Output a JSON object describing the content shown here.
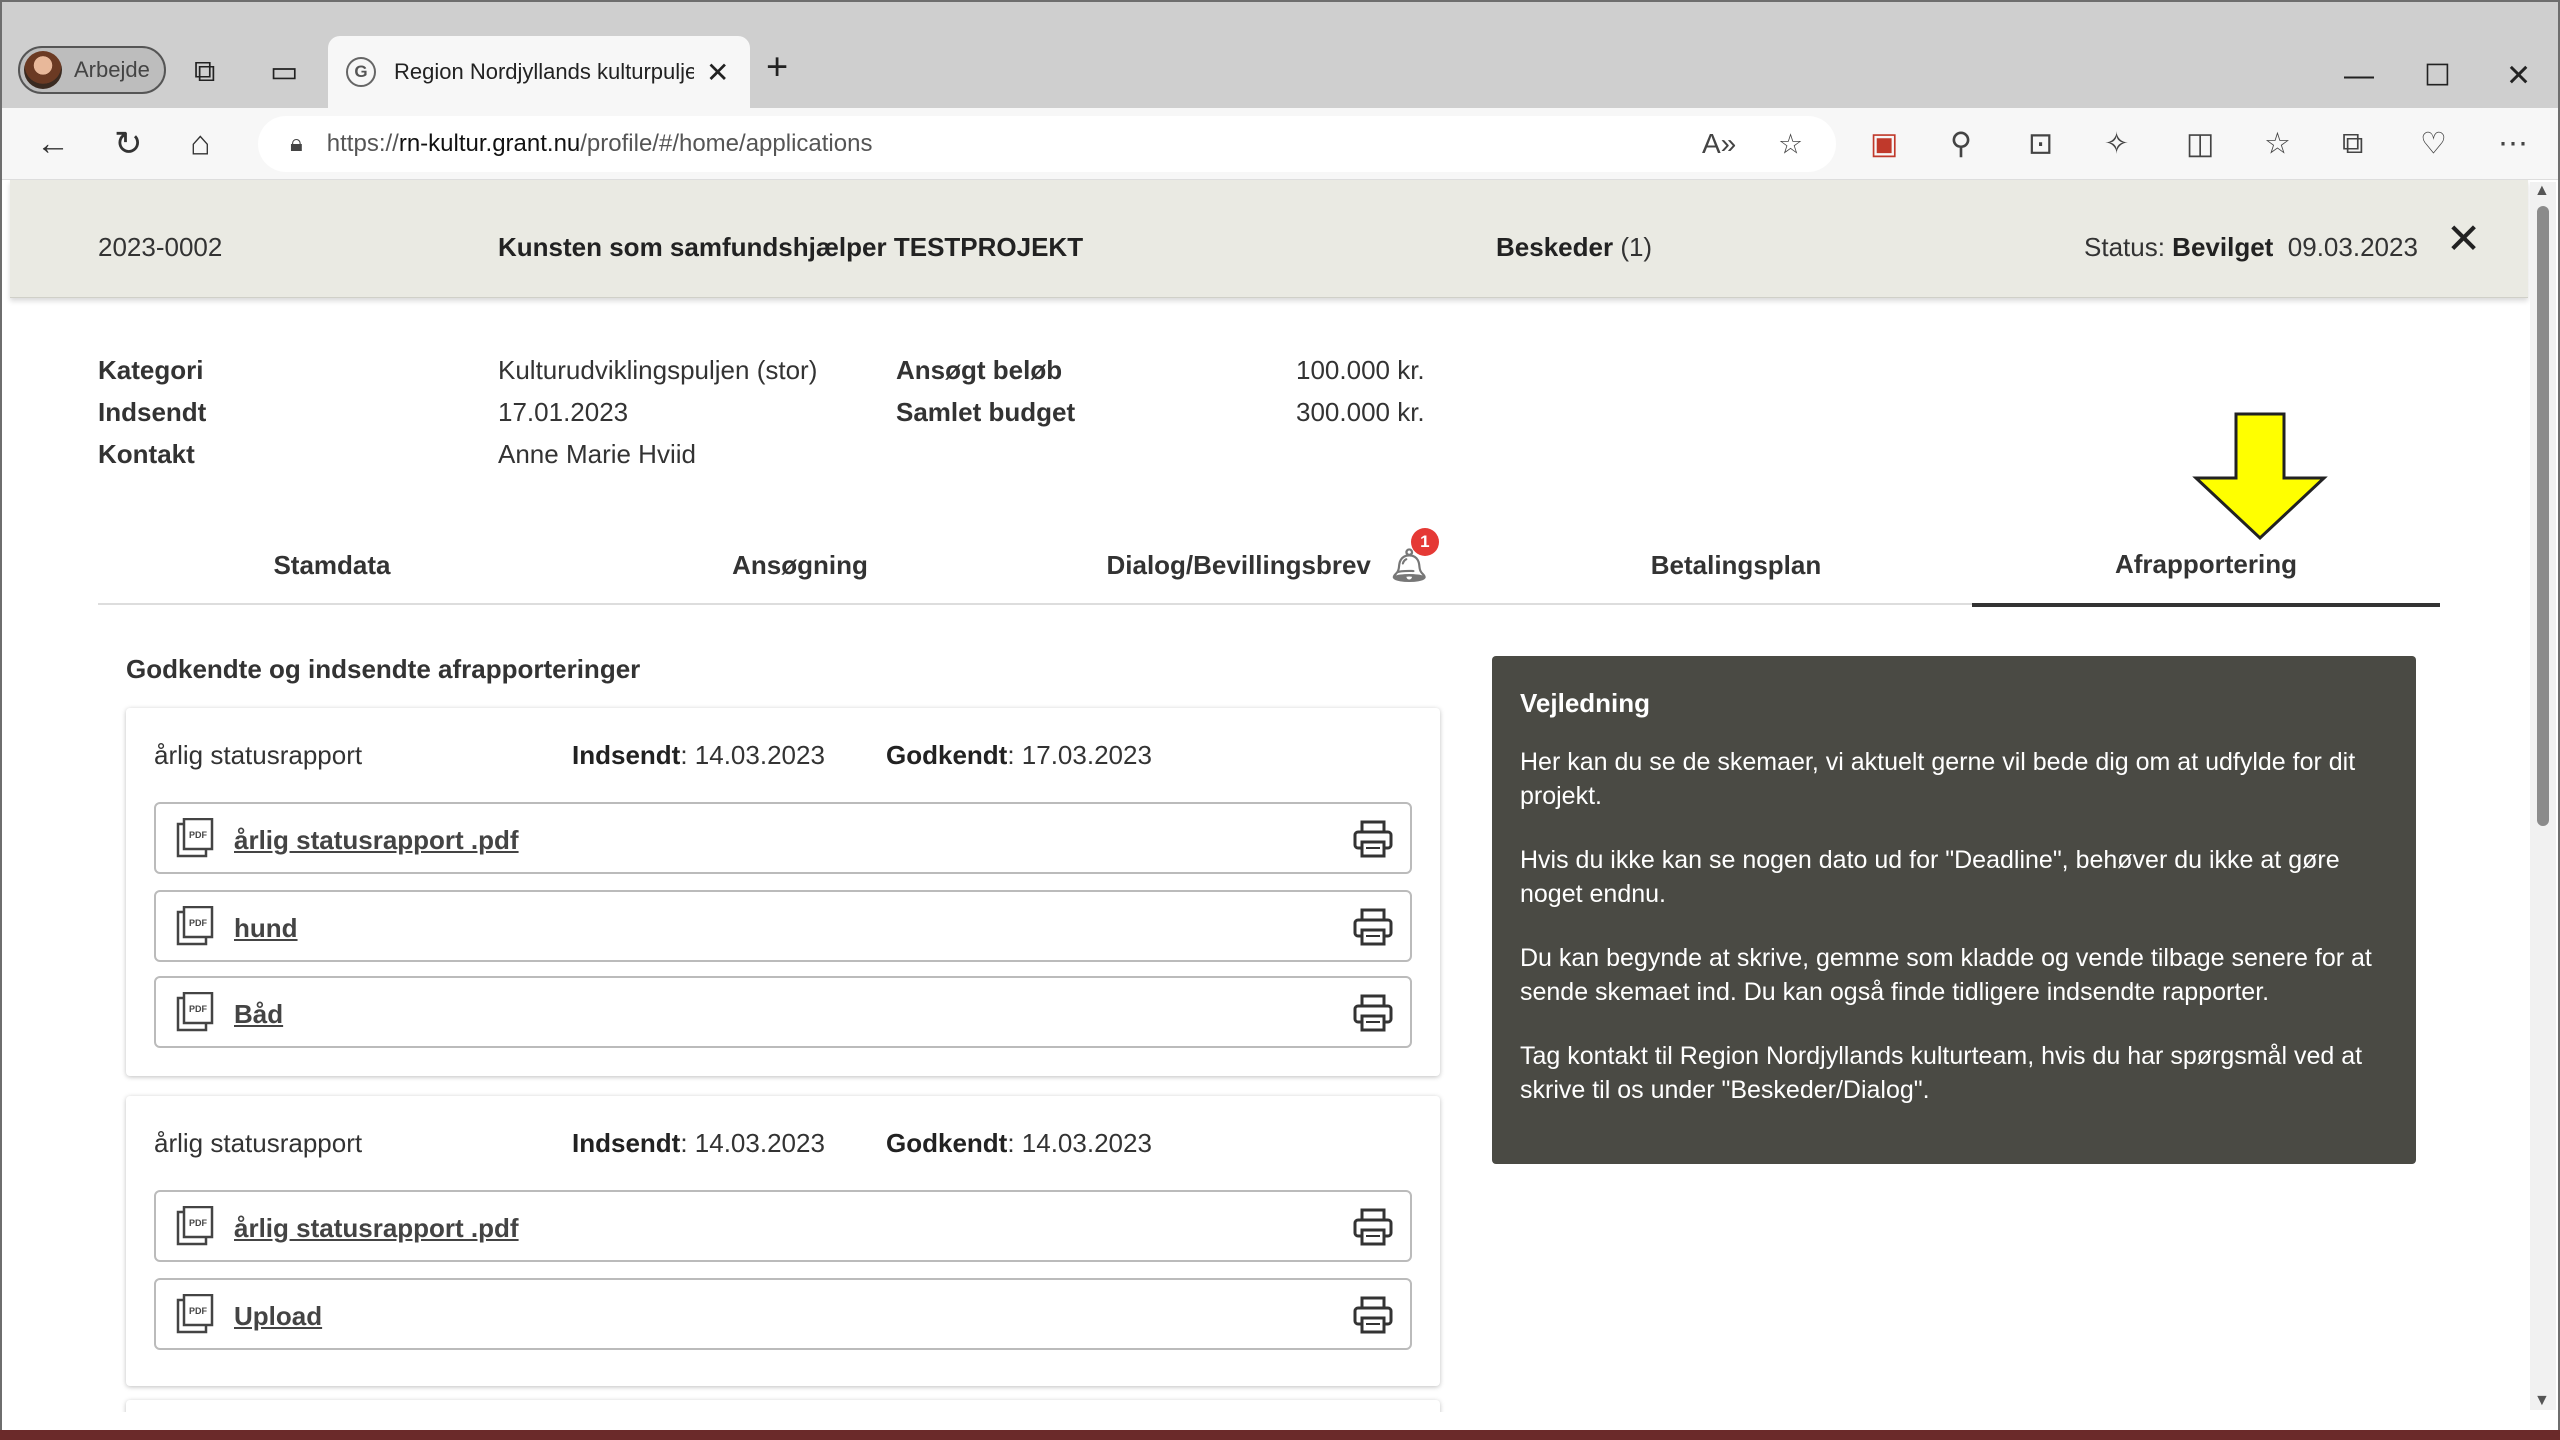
{
  "browser": {
    "profile_name": "Arbejde",
    "tab_title": "Region Nordjyllands kulturpuljer",
    "tab_favicon_letter": "G",
    "url_prefix": "https://",
    "url_domain": "rn-kultur.grant.nu",
    "url_path": "/profile/#/home/applications"
  },
  "header": {
    "app_id": "2023-0002",
    "project_title": "Kunsten som samfundshjælper TESTPROJEKT",
    "messages_label": "Beskeder",
    "messages_count": "(1)",
    "status_label": "Status:",
    "status_value": "Bevilget",
    "status_date": "09.03.2023"
  },
  "meta": {
    "kategori_label": "Kategori",
    "kategori_value": "Kulturudviklingspuljen (stor)",
    "indsendt_label": "Indsendt",
    "indsendt_value": "17.01.2023",
    "kontakt_label": "Kontakt",
    "kontakt_value": "Anne Marie Hviid",
    "ansogt_label": "Ansøgt beløb",
    "ansogt_value": "100.000 kr.",
    "budget_label": "Samlet budget",
    "budget_value": "300.000 kr."
  },
  "tabs": [
    {
      "label": "Stamdata"
    },
    {
      "label": "Ansøgning"
    },
    {
      "label": "Dialog/Bevillingsbrev",
      "badge": "1"
    },
    {
      "label": "Betalingsplan"
    },
    {
      "label": "Afrapportering"
    }
  ],
  "reports_section": {
    "title": "Godkendte og indsendte afrapporteringer",
    "cards": [
      {
        "name": "årlig statusrapport",
        "submitted_label": "Indsendt",
        "submitted_value": ": 14.03.2023",
        "approved_label": "Godkendt",
        "approved_value": ": 17.03.2023",
        "files": [
          "årlig statusrapport .pdf",
          "hund",
          "Båd"
        ]
      },
      {
        "name": "årlig statusrapport",
        "submitted_label": "Indsendt",
        "submitted_value": ": 14.03.2023",
        "approved_label": "Godkendt",
        "approved_value": ": 14.03.2023",
        "files": [
          "årlig statusrapport .pdf",
          "Upload"
        ]
      }
    ]
  },
  "guide": {
    "title": "Vejledning",
    "paragraphs": [
      "Her kan du se de skemaer, vi aktuelt gerne vil bede dig om at udfylde for dit projekt.",
      "Hvis du ikke kan se nogen dato ud for \"Deadline\", behøver du ikke at gøre noget endnu.",
      "Du kan begynde at skrive, gemme som kladde og vende tilbage senere for at sende skemaet ind. Du kan også finde tidligere indsendte rapporter.",
      "Tag kontakt til Region Nordjyllands kulturteam, hvis du har spørgsmål ved at skrive til os under \"Beskeder/Dialog\"."
    ]
  },
  "colors": {
    "header_bg": "#eaeae3",
    "guide_bg": "#4a4a44",
    "arrow_fill": "#ffff00",
    "badge": "#e53935"
  }
}
